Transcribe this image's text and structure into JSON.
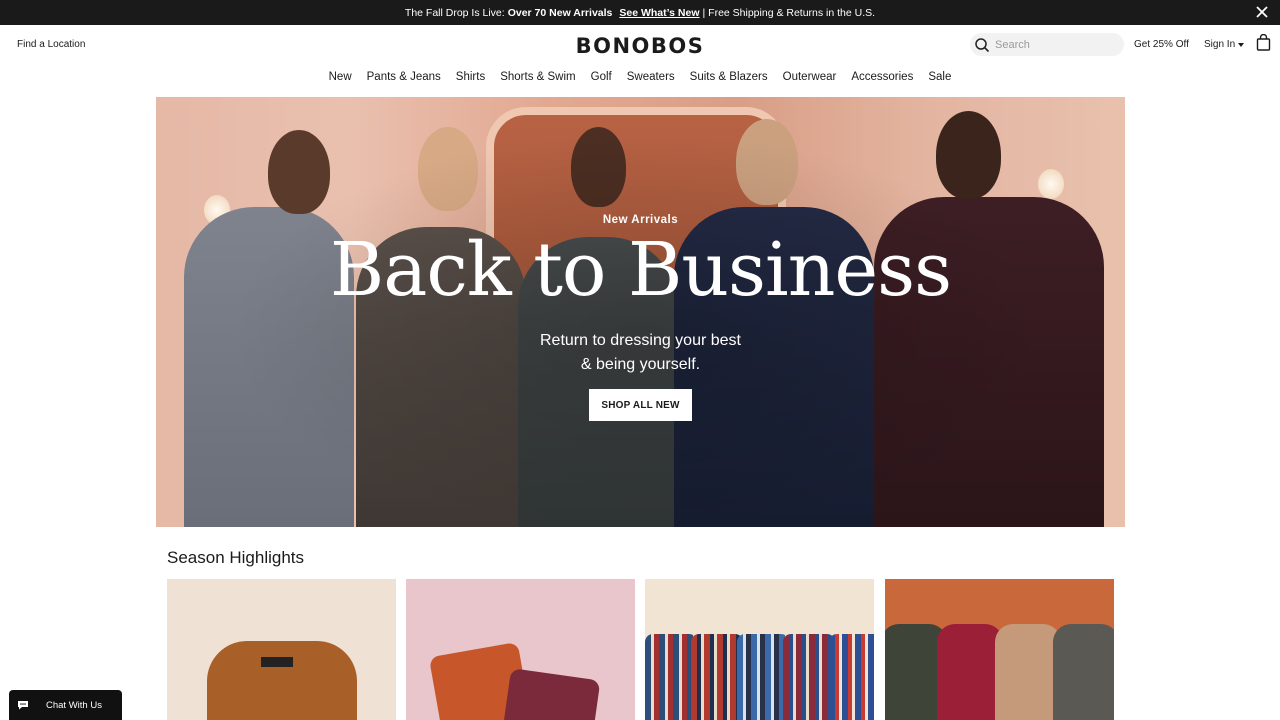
{
  "promo": {
    "lead": "The Fall Drop Is Live:",
    "highlight": "Over 70 New Arrivals",
    "link": "See What’s New",
    "tail": "| Free Shipping & Returns in the U.S."
  },
  "header": {
    "find_location": "Find a Location",
    "logo": "BONOBOS",
    "search_placeholder": "Search",
    "get_off": "Get 25% Off",
    "sign_in": "Sign In"
  },
  "nav": {
    "items": [
      "New",
      "Pants & Jeans",
      "Shirts",
      "Shorts & Swim",
      "Golf",
      "Sweaters",
      "Suits & Blazers",
      "Outerwear",
      "Accessories",
      "Sale"
    ]
  },
  "hero": {
    "eyebrow": "New Arrivals",
    "title": "Back to Business",
    "subtitle_line1": "Return to dressing your best",
    "subtitle_line2": "& being yourself.",
    "cta": "SHOP ALL NEW"
  },
  "highlights": {
    "title": "Season Highlights"
  },
  "chat": {
    "label": "Chat With Us"
  },
  "colors": {
    "promo_bg": "#1a1a1a",
    "text": "#1b1b1b",
    "search_bg": "#f2f2f2"
  }
}
